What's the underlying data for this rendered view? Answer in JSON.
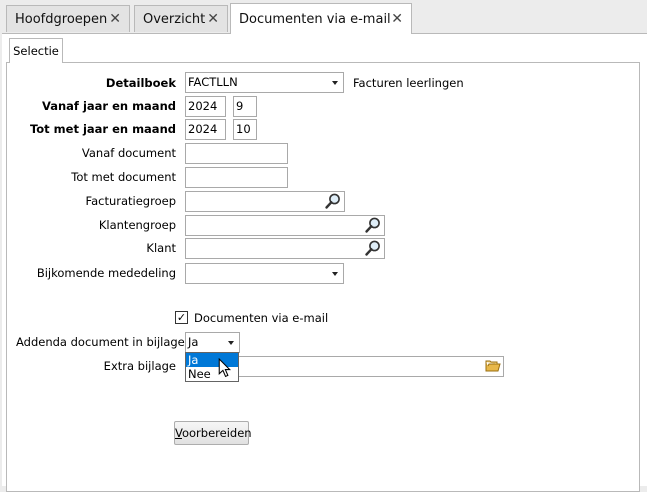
{
  "tabs": [
    {
      "label": "Hoofdgroepen",
      "close": "✕"
    },
    {
      "label": "Overzicht",
      "close": "✕"
    },
    {
      "label": "Documenten via e-mail",
      "close": "✕"
    }
  ],
  "subtab": {
    "label": "Selectie"
  },
  "form": {
    "detailboek": {
      "label": "Detailboek",
      "value": "FACTLLN",
      "description": "Facturen leerlingen"
    },
    "vanaf_jaar_maand": {
      "label": "Vanaf jaar en maand",
      "year": "2024",
      "month": "9"
    },
    "tot_jaar_maand": {
      "label": "Tot met jaar en maand",
      "year": "2024",
      "month": "10"
    },
    "vanaf_document": {
      "label": "Vanaf document",
      "value": ""
    },
    "tot_document": {
      "label": "Tot met document",
      "value": ""
    },
    "facturatiegroep": {
      "label": "Facturatiegroep",
      "value": ""
    },
    "klantengroep": {
      "label": "Klantengroep",
      "value": ""
    },
    "klant": {
      "label": "Klant",
      "value": ""
    },
    "bijkomende_mededeling": {
      "label": "Bijkomende mededeling",
      "value": ""
    },
    "documenten_email": {
      "label": "Documenten via e-mail",
      "checked": true,
      "check": "✓"
    },
    "addenda": {
      "label": "Addenda document in bijlage",
      "value": "Ja",
      "options": [
        "Ja",
        "Nee"
      ]
    },
    "extra_bijlage": {
      "label": "Extra bijlage",
      "value": ""
    }
  },
  "actions": {
    "voorbereiden": "Voorbereiden",
    "voorbereiden_accesskey": "V",
    "voorbereiden_rest": "oorbereiden"
  }
}
